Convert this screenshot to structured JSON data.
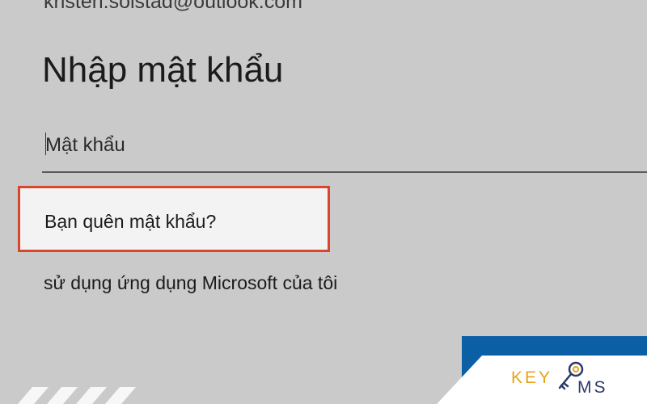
{
  "login": {
    "email": "kristen.solstad@outlook.com",
    "title": "Nhập mật khẩu",
    "password_placeholder": "Mật khẩu",
    "forgot_password": "Bạn quên mật khẩu?",
    "use_app": "sử dụng ứng dụng Microsoft của tôi"
  },
  "watermark": {
    "logo_left": "KEY",
    "logo_right": "MS"
  },
  "colors": {
    "background": "#cacaca",
    "highlight_border": "#d9462c",
    "primary_button": "#0b5fa4",
    "logo_gold": "#e8a317",
    "logo_navy": "#2b3a67"
  }
}
